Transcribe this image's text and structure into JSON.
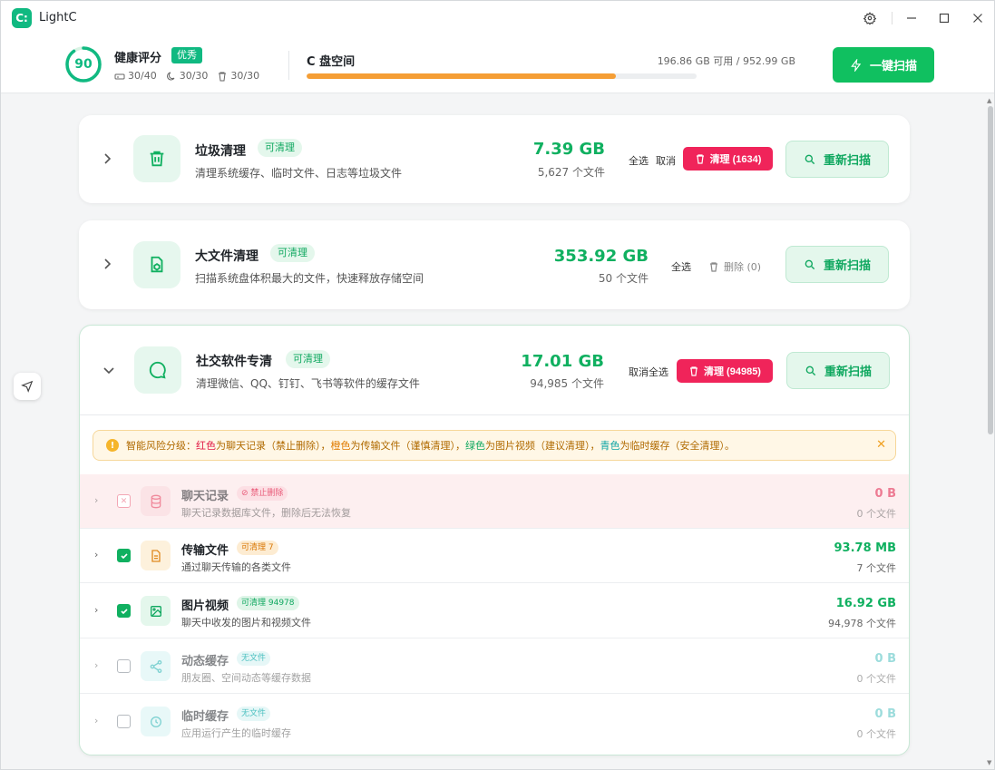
{
  "app": {
    "name": "LightC",
    "logo": "C:"
  },
  "header": {
    "score": "90",
    "score_fraction": 0.9,
    "health_title": "健康评分",
    "health_badge": "优秀",
    "stats": [
      {
        "icon": "disk-icon",
        "value": "30/40"
      },
      {
        "icon": "clock-icon",
        "value": "30/30"
      },
      {
        "icon": "trash-icon",
        "value": "30/30"
      }
    ],
    "disk_title": "C 盘空间",
    "disk_usage": "196.86 GB 可用 / 952.99 GB",
    "disk_used_fraction": 0.794,
    "scan_all_label": "一键扫描"
  },
  "cards": [
    {
      "title": "垃圾清理",
      "tag": "可清理",
      "desc": "清理系统缓存、临时文件、日志等垃圾文件",
      "size": "7.39 GB",
      "count": "5,627 个文件",
      "select_all": "全选",
      "cancel": "取消",
      "clean_label": "清理 (1634)",
      "rescan_label": "重新扫描"
    },
    {
      "title": "大文件清理",
      "tag": "可清理",
      "desc": "扫描系统盘体积最大的文件，快速释放存储空间",
      "size": "353.92 GB",
      "count": "50 个文件",
      "select_all": "全选",
      "delete_label": "删除 (0)",
      "rescan_label": "重新扫描"
    },
    {
      "title": "社交软件专清",
      "tag": "可清理",
      "desc": "清理微信、QQ、钉钉、飞书等软件的缓存文件",
      "size": "17.01 GB",
      "count": "94,985 个文件",
      "deselect_all": "取消全选",
      "clean_label": "清理 (94985)",
      "rescan_label": "重新扫描"
    }
  ],
  "notice": {
    "prefix": "智能风险分级：",
    "red": "红色",
    "red_text": "为聊天记录（禁止删除），",
    "orange": "橙色",
    "orange_text": "为传输文件（谨慎清理），",
    "green": "绿色",
    "green_text": "为图片视频（建议清理），",
    "cyan": "青色",
    "cyan_text": "为临时缓存（安全清理）。"
  },
  "rows": [
    {
      "title": "聊天记录",
      "tag": "⊘ 禁止删除",
      "desc": "聊天记录数据库文件，删除后无法恢复",
      "size": "0 B",
      "count": "0 个文件"
    },
    {
      "title": "传输文件",
      "tag": "可清理 7",
      "desc": "通过聊天传输的各类文件",
      "size": "93.78 MB",
      "count": "7 个文件"
    },
    {
      "title": "图片视频",
      "tag": "可清理 94978",
      "desc": "聊天中收发的图片和视频文件",
      "size": "16.92 GB",
      "count": "94,978 个文件"
    },
    {
      "title": "动态缓存",
      "tag": "无文件",
      "desc": "朋友圈、空间动态等缓存数据",
      "size": "0 B",
      "count": "0 个文件"
    },
    {
      "title": "临时缓存",
      "tag": "无文件",
      "desc": "应用运行产生的临时缓存",
      "size": "0 B",
      "count": "0 个文件"
    }
  ]
}
